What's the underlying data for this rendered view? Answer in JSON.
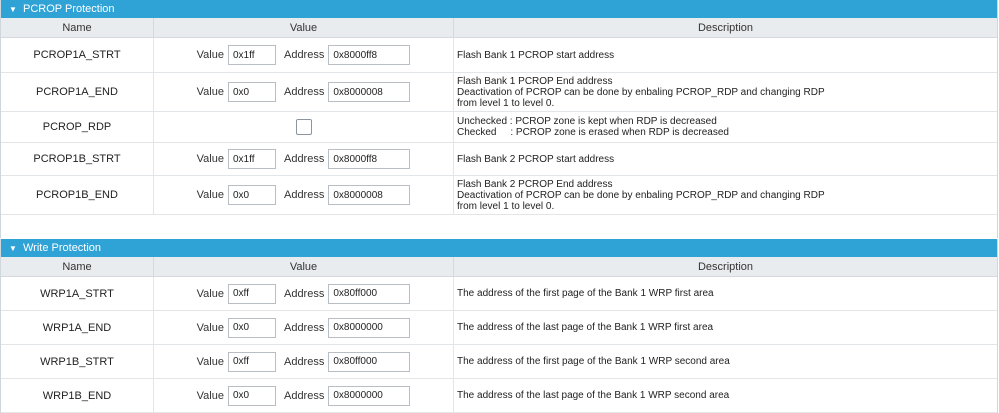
{
  "pcrop": {
    "title": "PCROP Protection",
    "headers": [
      "Name",
      "Value",
      "Description"
    ],
    "rows": [
      {
        "name": "PCROP1A_STRT",
        "value_label": "Value",
        "value": "0x1ff",
        "address_label": "Address",
        "address": "0x8000ff8",
        "desc": [
          "Flash Bank 1 PCROP start address"
        ]
      },
      {
        "name": "PCROP1A_END",
        "value_label": "Value",
        "value": "0x0",
        "address_label": "Address",
        "address": "0x8000008",
        "desc": [
          "Flash Bank 1 PCROP End address",
          "Deactivation of PCROP can be done by enbaling PCROP_RDP and changing RDP",
          "from level 1 to level 0."
        ]
      },
      {
        "name": "PCROP_RDP",
        "checked": false,
        "desc": [
          "Unchecked : PCROP zone is kept when RDP is decreased",
          "Checked     : PCROP zone is erased when RDP is decreased"
        ]
      },
      {
        "name": "PCROP1B_STRT",
        "value_label": "Value",
        "value": "0x1ff",
        "address_label": "Address",
        "address": "0x8000ff8",
        "desc": [
          "Flash Bank 2 PCROP start address"
        ]
      },
      {
        "name": "PCROP1B_END",
        "value_label": "Value",
        "value": "0x0",
        "address_label": "Address",
        "address": "0x8000008",
        "desc": [
          "Flash Bank 2 PCROP End address",
          "Deactivation of PCROP can be done by enbaling PCROP_RDP and changing RDP",
          "from level 1 to level 0."
        ]
      }
    ]
  },
  "wrp": {
    "title": "Write Protection",
    "headers": [
      "Name",
      "Value",
      "Description"
    ],
    "rows": [
      {
        "name": "WRP1A_STRT",
        "value_label": "Value",
        "value": "0xff",
        "address_label": "Address",
        "address": "0x80ff000",
        "desc": [
          "The address of the first page of the Bank 1 WRP first area"
        ]
      },
      {
        "name": "WRP1A_END",
        "value_label": "Value",
        "value": "0x0",
        "address_label": "Address",
        "address": "0x8000000",
        "desc": [
          "The address of the last page of the Bank 1 WRP first area"
        ]
      },
      {
        "name": "WRP1B_STRT",
        "value_label": "Value",
        "value": "0xff",
        "address_label": "Address",
        "address": "0x80ff000",
        "desc": [
          "The address of the first page of the Bank 1 WRP second area"
        ]
      },
      {
        "name": "WRP1B_END",
        "value_label": "Value",
        "value": "0x0",
        "address_label": "Address",
        "address": "0x8000000",
        "desc": [
          "The address of the last page of the Bank 1 WRP second area"
        ]
      }
    ]
  },
  "colors": {
    "header_bar": "#2fa3d6",
    "column_header": "#e9ecef"
  },
  "icons": {
    "collapse": "chevron-down-icon"
  }
}
